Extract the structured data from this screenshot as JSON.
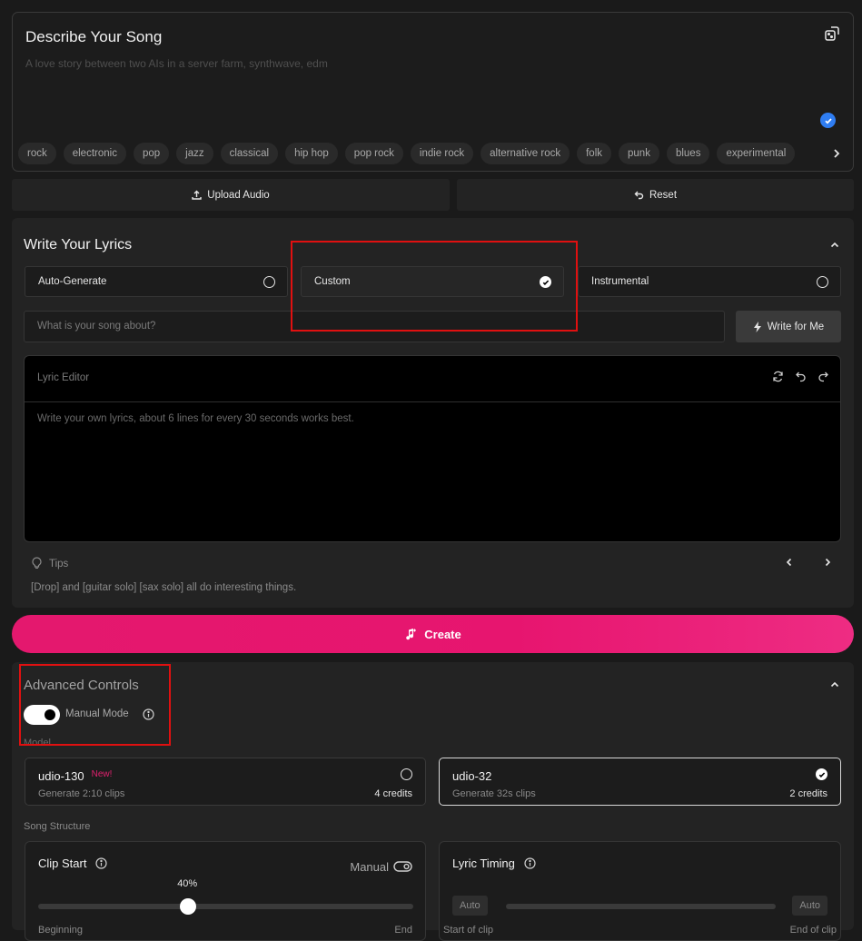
{
  "describe": {
    "title": "Describe Your Song",
    "placeholder": "A love story between two AIs in a server farm, synthwave, edm",
    "genres": [
      "rock",
      "electronic",
      "pop",
      "jazz",
      "classical",
      "hip hop",
      "pop rock",
      "indie rock",
      "alternative rock",
      "folk",
      "punk",
      "blues",
      "experimental"
    ]
  },
  "actions": {
    "upload": "Upload Audio",
    "reset": "Reset"
  },
  "lyrics": {
    "title": "Write Your Lyrics",
    "options": [
      "Auto-Generate",
      "Custom",
      "Instrumental"
    ],
    "selected": 1,
    "about_placeholder": "What is your song about?",
    "write_for_me": "Write for Me",
    "editor_label": "Lyric Editor",
    "editor_placeholder": "Write your own lyrics, about 6 lines for every 30 seconds works best.",
    "tips_label": "Tips",
    "tip_text": "[Drop] and [guitar solo] [sax solo] all do interesting things."
  },
  "create": "Create",
  "advanced": {
    "title": "Advanced Controls",
    "manual_mode": "Manual Mode",
    "manual_on": true,
    "model_label": "Model",
    "models": [
      {
        "name": "udio-130",
        "badge": "New!",
        "sub": "Generate 2:10 clips",
        "credits": "4 credits",
        "selected": false
      },
      {
        "name": "udio-32",
        "badge": "",
        "sub": "Generate 32s clips",
        "credits": "2 credits",
        "selected": true
      }
    ],
    "structure_label": "Song Structure",
    "clip_start": {
      "title": "Clip Start",
      "manual": "Manual",
      "value_label": "40%",
      "value": 40,
      "left": "Beginning",
      "right": "End"
    },
    "lyric_timing": {
      "title": "Lyric Timing",
      "auto_left": "Auto",
      "auto_right": "Auto",
      "left": "Start of clip",
      "right": "End of clip"
    }
  },
  "colors": {
    "accent": "#e4186e",
    "check": "#2f7df1",
    "highlight": "#e01010"
  }
}
